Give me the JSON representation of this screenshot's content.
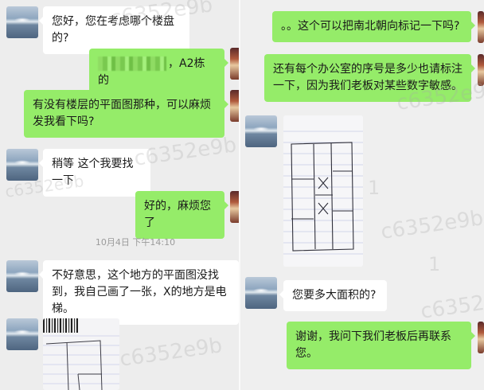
{
  "left_chat": {
    "messages": [
      {
        "text": "您好，您在考虑哪个楼盘的?"
      },
      {
        "text": "，A2栋的"
      },
      {
        "text": "有没有楼层的平面图那种，可以麻烦发我看下吗?"
      },
      {
        "text": "稍等 这个我要找一下"
      },
      {
        "text": "好的，麻烦您了"
      },
      {
        "text": "不好意思，这个地方的平面图没找到，我自己画了一张，X的地方是电梯。"
      }
    ],
    "timestamp": "10月4日 下午14:10"
  },
  "right_chat": {
    "messages": [
      {
        "text": "。。这个可以把南北朝向标记一下吗?"
      },
      {
        "text": "还有每个办公室的序号是多少也请标注一下，因为我们老板对某些数字敏感。"
      },
      {
        "text": "您要多大面积的?"
      },
      {
        "text": "谢谢，我问下我们老板后再联系您。"
      }
    ]
  },
  "watermark": {
    "code": "c6352e9b",
    "number": "1"
  },
  "colors": {
    "incoming_bubble": "#ffffff",
    "outgoing_bubble": "#95ec69",
    "background": "#ededed"
  }
}
